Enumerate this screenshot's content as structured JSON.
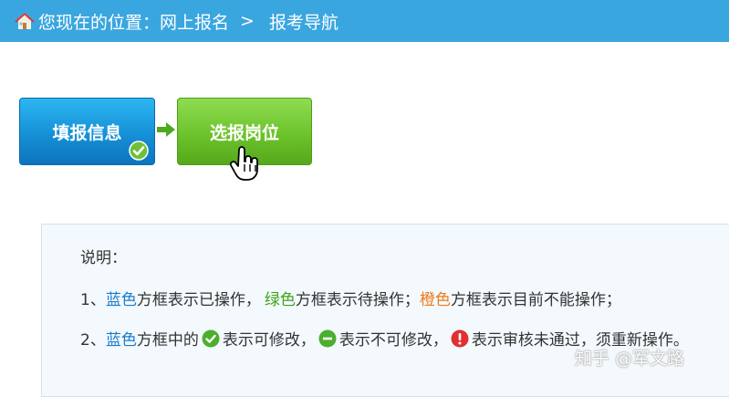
{
  "breadcrumb": {
    "location_label": "您现在的位置：网上报名",
    "separator": ">",
    "current": "报考导航"
  },
  "steps": [
    {
      "label": "填报信息",
      "status": "done",
      "color": "#1590d6"
    },
    {
      "label": "选报岗位",
      "status": "pending",
      "color": "#6cc32b"
    }
  ],
  "info": {
    "title": "说明：",
    "line1": {
      "prefix": "1、",
      "blue_word": "蓝色",
      "blue_desc": "方框表示已操作，",
      "green_word": "绿色",
      "green_desc": "方框表示待操作；",
      "orange_word": "橙色",
      "orange_desc": "方框表示目前不能操作；"
    },
    "line2": {
      "prefix": "2、",
      "blue_word": "蓝色",
      "mid": "方框中的",
      "editable": "表示可修改，",
      "not_editable": "表示不可修改，",
      "rejected": "表示审核未通过，须重新操作。"
    }
  },
  "watermark": "知乎 @军文路",
  "colors": {
    "header": "#3aa6df",
    "blue": "#1a7bd0",
    "green": "#3fa31a",
    "orange": "#f07a1e"
  }
}
